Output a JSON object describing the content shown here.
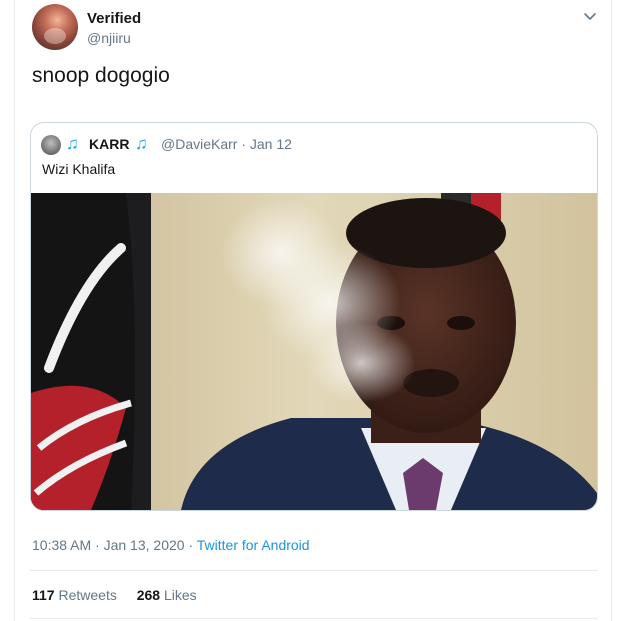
{
  "author": {
    "name": "Verified",
    "handle": "@njiiru"
  },
  "tweet": {
    "text": "snoop dogogio"
  },
  "quoted_tweet": {
    "name": "KARR",
    "note_glyph": "♫",
    "handle_date": "@DavieKarr · Jan 12",
    "text": "Wizi Khalifa"
  },
  "meta": {
    "time": "10:38 AM · Jan 13, 2020 · ",
    "source": "Twitter for Android"
  },
  "stats": {
    "retweets_count": "117",
    "retweets_label": "Retweets",
    "likes_count": "268",
    "likes_label": "Likes"
  },
  "colors": {
    "link_blue": "#1da1f2",
    "secondary_text": "#657786",
    "border": "#e6ecf0"
  },
  "icons": {
    "more": "chevron-down-icon",
    "note": "music-note-icon"
  }
}
